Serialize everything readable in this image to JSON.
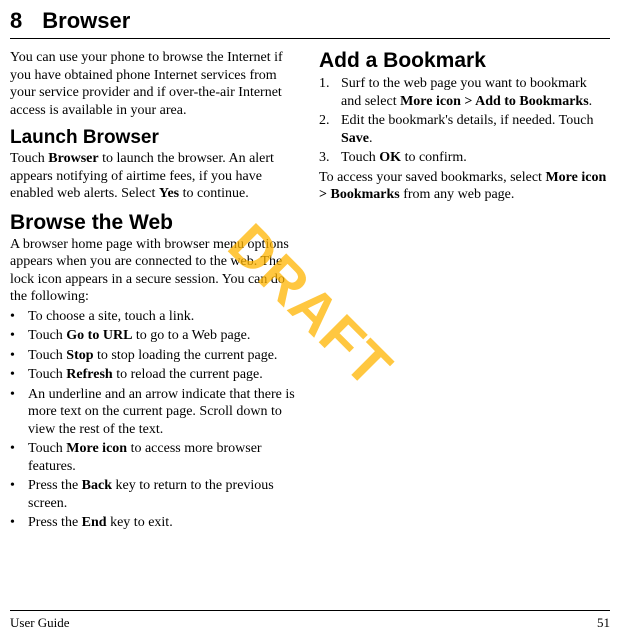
{
  "chapter": {
    "number": "8",
    "title": "Browser"
  },
  "watermark": "DRAFT",
  "left": {
    "intro": "You can use your phone to browse the Internet if you have obtained phone Internet services from your service provider and if over-the-air Internet access is available in your area.",
    "launch_heading": "Launch Browser",
    "launch_p1a": "Touch ",
    "launch_p1_bold1": "Browser",
    "launch_p1b": " to launch the browser. An alert appears notifying of airtime fees, if you have enabled web alerts. Select ",
    "launch_p1_bold2": "Yes",
    "launch_p1c": " to continue.",
    "browse_heading": "Browse the Web",
    "browse_intro": "A browser home page with browser menu options appears when you are connected to the web. The lock icon appears in a secure session. You can do the following:",
    "items": [
      {
        "a": "To choose a site, touch a link."
      },
      {
        "a": "Touch ",
        "b": "Go to URL",
        "c": " to go to a Web page."
      },
      {
        "a": "Touch ",
        "b": "Stop",
        "c": " to stop loading the current page."
      },
      {
        "a": "Touch ",
        "b": "Refresh",
        "c": " to reload the current page."
      },
      {
        "a": "An underline and an arrow indicate that there is more text on the current page. Scroll down to view the rest of the text."
      },
      {
        "a": "Touch ",
        "b": "More icon",
        "c": " to access more browser features."
      },
      {
        "a": "Press the ",
        "b": "Back",
        "c": " key to return to the previous screen."
      },
      {
        "a": "Press the ",
        "b": "End",
        "c": " key to exit."
      }
    ]
  },
  "right": {
    "bookmark_heading": "Add a Bookmark",
    "steps": [
      {
        "a": "Surf to the web page you want to bookmark and select ",
        "b": "More icon > Add to Bookmarks",
        "c": "."
      },
      {
        "a": "Edit the bookmark's details, if needed. Touch ",
        "b": "Save",
        "c": "."
      },
      {
        "a": "Touch ",
        "b": "OK",
        "c": " to confirm."
      }
    ],
    "tail_a": "To access your saved bookmarks, select ",
    "tail_b1": "More icon > Bookmarks",
    "tail_c": " from any web page."
  },
  "footer": {
    "left": "User Guide",
    "right": "51"
  }
}
